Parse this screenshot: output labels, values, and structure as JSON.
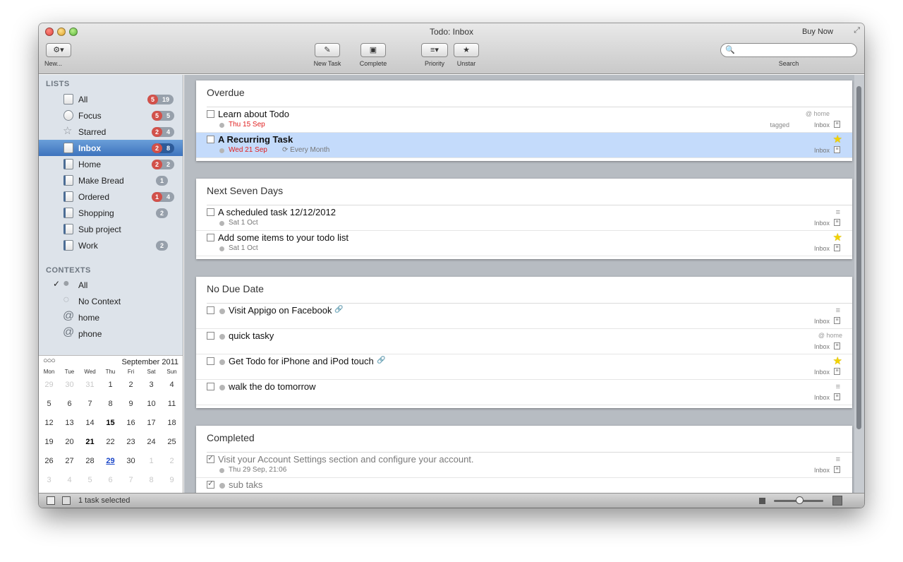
{
  "window": {
    "title": "Todo: Inbox",
    "buy_now": "Buy Now",
    "resize_glyph": "⤢"
  },
  "toolbar": {
    "new_glyph": "⚙▾",
    "new_label": "New...",
    "new_task_glyph": "✎",
    "new_task_label": "New Task",
    "complete_glyph": "▣",
    "complete_label": "Complete",
    "priority_glyph": "≡▾",
    "priority_label": "Priority",
    "unstar_glyph": "★",
    "unstar_label": "Unstar",
    "search_glyph": "🔍",
    "search_label": "Search",
    "search_value": ""
  },
  "sidebar": {
    "lists_title": "LISTS",
    "lists": [
      {
        "label": "All",
        "badge_red": "5",
        "badge_grey": "19"
      },
      {
        "label": "Focus",
        "badge_red": "5",
        "badge_grey": "5"
      },
      {
        "label": "Starred",
        "badge_red": "2",
        "badge_grey": "4"
      },
      {
        "label": "Inbox",
        "badge_red": "2",
        "badge_grey": "8"
      },
      {
        "label": "Home",
        "badge_red": "2",
        "badge_grey": "2"
      },
      {
        "label": "Make Bread",
        "badge_grey": "1"
      },
      {
        "label": "Ordered",
        "badge_red": "1",
        "badge_grey": "4"
      },
      {
        "label": "Shopping",
        "badge_grey": "2"
      },
      {
        "label": "Sub project"
      },
      {
        "label": "Work",
        "badge_grey": "2"
      }
    ],
    "contexts_title": "CONTEXTS",
    "contexts": [
      {
        "label": "All",
        "check": "✓",
        "icon": "●"
      },
      {
        "label": "No Context",
        "icon": "○"
      },
      {
        "label": "home",
        "icon": "@"
      },
      {
        "label": "phone",
        "icon": "@"
      }
    ]
  },
  "calendar": {
    "nav": "○○○",
    "title": "September 2011",
    "weekdays": [
      "Mon",
      "Tue",
      "Wed",
      "Thu",
      "Fri",
      "Sat",
      "Sun"
    ],
    "weeks": [
      [
        "29",
        "30",
        "31",
        "1",
        "2",
        "3",
        "4"
      ],
      [
        "5",
        "6",
        "7",
        "8",
        "9",
        "10",
        "11"
      ],
      [
        "12",
        "13",
        "14",
        "15",
        "16",
        "17",
        "18"
      ],
      [
        "19",
        "20",
        "21",
        "22",
        "23",
        "24",
        "25"
      ],
      [
        "26",
        "27",
        "28",
        "29",
        "30",
        "1",
        "2"
      ],
      [
        "3",
        "4",
        "5",
        "6",
        "7",
        "8",
        "9"
      ]
    ]
  },
  "status": {
    "text": "1 task selected"
  },
  "sections": [
    {
      "title": "Overdue",
      "tasks": [
        {
          "title": "Learn about Todo",
          "due": "Thu 15 Sep",
          "context": "@ home",
          "tagged": "tagged",
          "list": "Inbox"
        },
        {
          "title": "A Recurring Task",
          "due": "Wed 21 Sep",
          "repeat": "⟳ Every Month",
          "list": "Inbox",
          "star": "★"
        }
      ]
    },
    {
      "title": "Next Seven Days",
      "tasks": [
        {
          "title": "A scheduled task 12/12/2012",
          "due": "Sat 1 Oct",
          "list": "Inbox"
        },
        {
          "title": "Add some items to your todo list",
          "due": "Sat 1 Oct",
          "list": "Inbox",
          "star": "★"
        }
      ]
    },
    {
      "title": "No Due Date",
      "tasks": [
        {
          "title": "Visit Appigo on Facebook",
          "link": "🔗",
          "list": "Inbox"
        },
        {
          "title": "quick tasky",
          "context": "@ home",
          "list": "Inbox"
        },
        {
          "title": "Get Todo for iPhone and iPod touch",
          "link": "🔗",
          "list": "Inbox",
          "star": "★"
        },
        {
          "title": "walk the do tomorrow",
          "list": "Inbox"
        }
      ]
    },
    {
      "title": "Completed",
      "tasks": [
        {
          "title": "Visit your Account Settings section and configure your account.",
          "due": "Thu 29 Sep, 21:06",
          "list": "Inbox",
          "check": "✓"
        },
        {
          "title": "sub taks",
          "check": "✓"
        }
      ]
    }
  ],
  "glyphs": {
    "note": "≡",
    "lines": "≡"
  },
  "colors": {
    "selection": "#3e73bd",
    "overdue": "#e02020",
    "star": "#f2d200"
  }
}
